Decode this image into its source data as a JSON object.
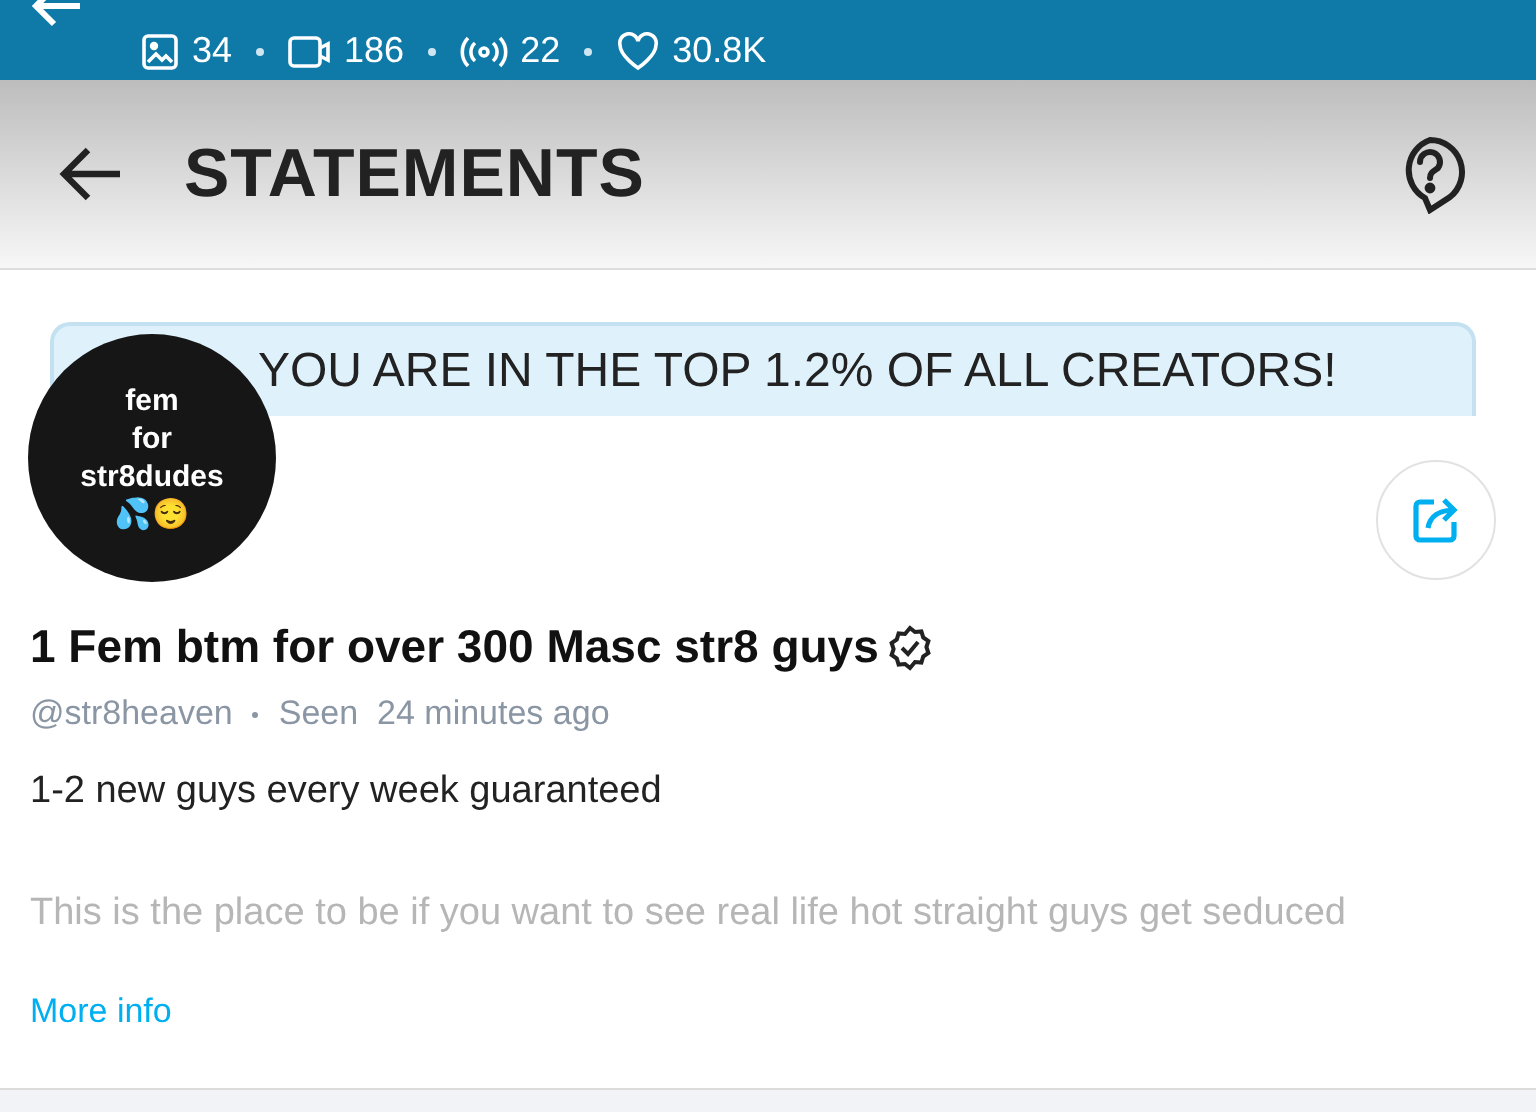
{
  "stats": [
    {
      "kind": "photos",
      "count": "34"
    },
    {
      "kind": "videos",
      "count": "186"
    },
    {
      "kind": "streams",
      "count": "22"
    },
    {
      "kind": "likes",
      "count": "30.8K"
    }
  ],
  "header": {
    "title": "STATEMENTS"
  },
  "banner": {
    "text": "YOU ARE IN THE TOP 1.2% OF ALL CREATORS!"
  },
  "avatar": {
    "lines": [
      "fem",
      "for",
      "str8dudes",
      "💦😌"
    ]
  },
  "profile": {
    "name": "1 Fem btm for over 300 Masc str8 guys",
    "verified": true,
    "handle": "@str8heaven",
    "seen": "Seen  24 minutes ago",
    "bio": "1-2 new guys every week guaranteed",
    "bio_more": "This is the place to be if you want to see real life hot straight guys get seduced",
    "more_link": "More info"
  }
}
